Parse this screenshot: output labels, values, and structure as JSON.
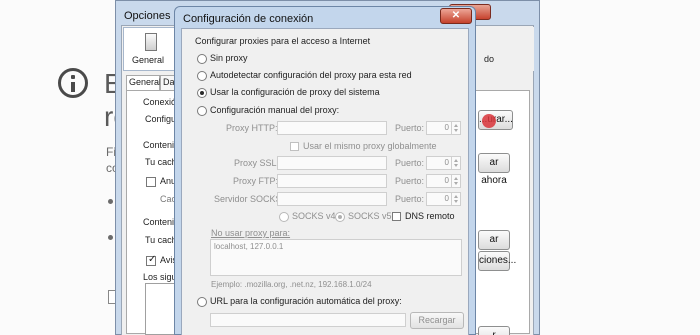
{
  "background": {
    "heading_line1": "E",
    "heading_line2": "re",
    "text_line1": "Fire",
    "text_line2": "co"
  },
  "options_window": {
    "title": "Opciones",
    "help_label": "?",
    "close_label": "✕",
    "toolbar": {
      "general_label": "General",
      "right_label": "do"
    },
    "subtabs": [
      "General",
      "Dat"
    ],
    "section_labels": {
      "connection_heading": "Conexión",
      "configure": "Configure",
      "content1": "Contenid",
      "cache1": "Tu cache",
      "anul": "Anul",
      "cach": "Cach",
      "content2": "Contenid",
      "cache2": "Tu cache",
      "avis": "Avis",
      "siguientes": "Los siguie"
    },
    "buttons": {
      "configure": "...urar...",
      "clear_now_1": "ar ahora",
      "clear_now_2": "ar ahora",
      "exceptions": "ciones...",
      "bottom": "r ahora"
    }
  },
  "dialog": {
    "title": "Configuración de conexión",
    "close_label": "✕",
    "section_label": "Configurar proxies para el acceso a Internet",
    "options": {
      "no_proxy": "Sin proxy",
      "autodetect": "Autodetectar configuración del proxy para esta red",
      "system": "Usar la configuración de proxy del sistema",
      "manual": "Configuración manual del proxy:",
      "auto_url": "URL para la configuración automática del proxy:"
    },
    "selected_option": "system",
    "manual": {
      "http_label": "Proxy HTTP:",
      "ssl_label": "Proxy SSL:",
      "ftp_label": "Proxy FTP:",
      "socks_label": "Servidor SOCKS:",
      "port_label": "Puerto:",
      "http_port": "0",
      "ssl_port": "0",
      "ftp_port": "0",
      "socks_port": "0",
      "same_proxy_label": "Usar el mismo proxy globalmente",
      "socks_v4": "SOCKS v4",
      "socks_v5": "SOCKS v5",
      "socks_version_selected": "v5",
      "dns_remote": "DNS remoto"
    },
    "no_proxy_for": {
      "label": "No usar proxy para:",
      "value": "localhost, 127.0.0.1",
      "example": "Ejemplo: .mozilla.org, .net.nz, 192.168.1.0/24"
    },
    "reload_button": "Recargar"
  },
  "colors": {
    "title_bar": "#c3d6ec",
    "close_red": "#c7422e",
    "window_bg": "#f0f0f0"
  }
}
